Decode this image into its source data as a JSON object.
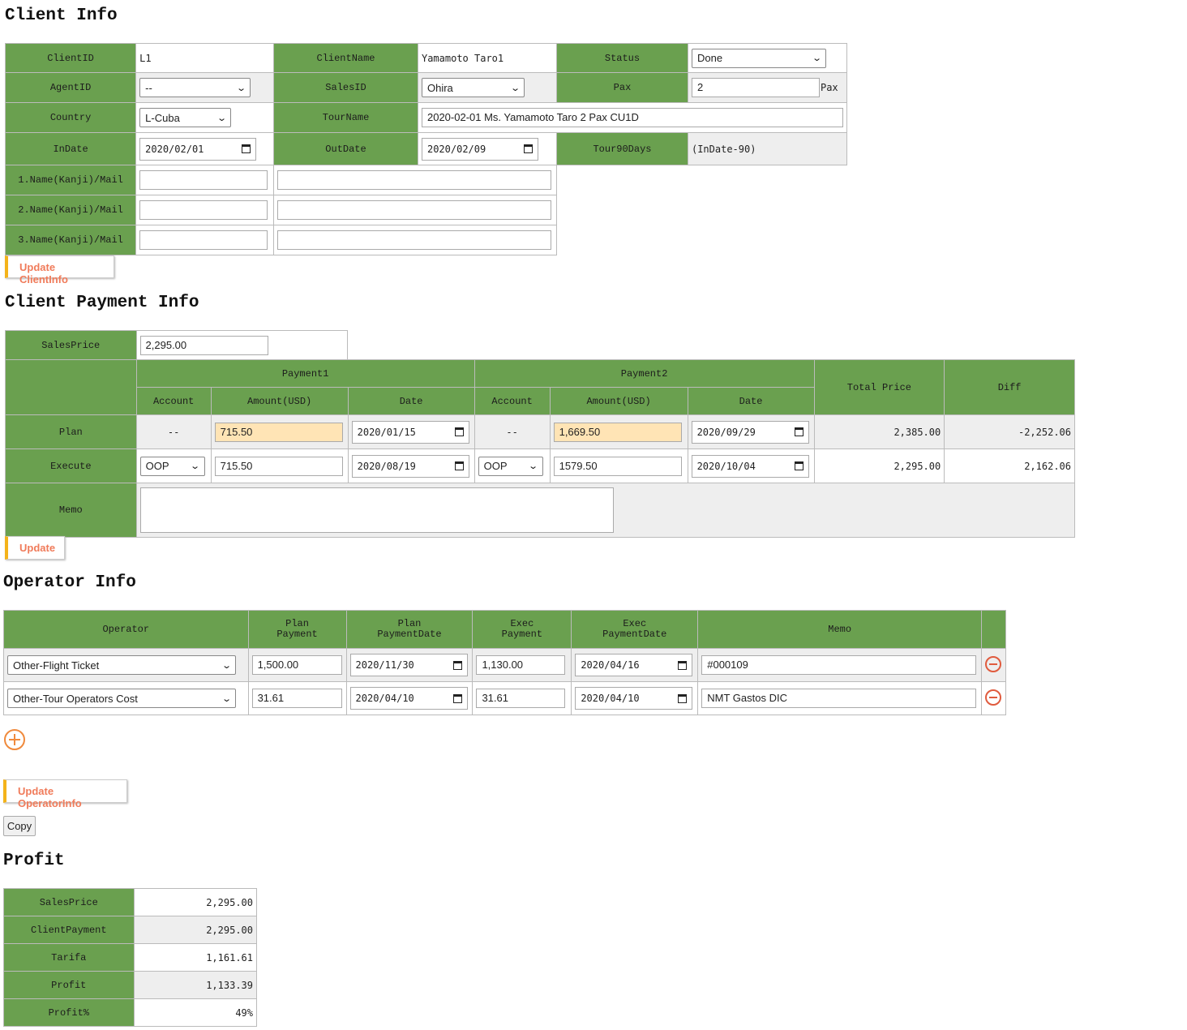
{
  "client_info": {
    "title": "Client Info",
    "client_id_label": "ClientID",
    "client_id": "L1",
    "client_name_label": "ClientName",
    "client_name": "Yamamoto Taro1",
    "status_label": "Status",
    "status": "Done",
    "agent_id_label": "AgentID",
    "agent_id": "--",
    "sales_id_label": "SalesID",
    "sales_id": "Ohira",
    "pax_label": "Pax",
    "pax": "2",
    "pax_unit": "Pax",
    "country_label": "Country",
    "country": "L-Cuba",
    "tour_name_label": "TourName",
    "tour_name": "2020-02-01 Ms. Yamamoto Taro 2 Pax CU1D",
    "in_date_label": "InDate",
    "in_date": "2020/02/01",
    "out_date_label": "OutDate",
    "out_date": "2020/02/09",
    "tour90_label": "Tour90Days",
    "tour90": "(InDate-90)",
    "name1_label": "1.Name(Kanji)/Mail",
    "name2_label": "2.Name(Kanji)/Mail",
    "name3_label": "3.Name(Kanji)/Mail",
    "update_button": "Update ClientInfo"
  },
  "payment_info": {
    "title": "Client Payment Info",
    "sales_price_label": "SalesPrice",
    "sales_price": "2,295.00",
    "payment1_label": "Payment1",
    "payment2_label": "Payment2",
    "total_price_label": "Total Price",
    "diff_label": "Diff",
    "account_label": "Account",
    "amount_label": "Amount(USD)",
    "date_label": "Date",
    "plan_label": "Plan",
    "plan_p1_account": "--",
    "plan_p1_amount": "715.50",
    "plan_p1_date": "2020/01/15",
    "plan_p2_account": "--",
    "plan_p2_amount": "1,669.50",
    "plan_p2_date": "2020/09/29",
    "plan_total": "2,385.00",
    "plan_diff": "-2,252.06",
    "execute_label": "Execute",
    "exec_p1_account": "OOP",
    "exec_p1_amount": "715.50",
    "exec_p1_date": "2020/08/19",
    "exec_p2_account": "OOP",
    "exec_p2_amount": "1579.50",
    "exec_p2_date": "2020/10/04",
    "exec_total": "2,295.00",
    "exec_diff": "2,162.06",
    "memo_label": "Memo",
    "update_button": "Update"
  },
  "operator_info": {
    "title": "Operator Info",
    "headers": {
      "operator": "Operator",
      "plan_payment_1": "Plan",
      "plan_payment_2": "Payment",
      "plan_date_1": "Plan",
      "plan_date_2": "PaymentDate",
      "exec_payment_1": "Exec",
      "exec_payment_2": "Payment",
      "exec_date_1": "Exec",
      "exec_date_2": "PaymentDate",
      "memo": "Memo"
    },
    "rows": [
      {
        "operator": "Other-Flight Ticket",
        "plan_payment": "1,500.00",
        "plan_date": "2020/11/30",
        "exec_payment": "1,130.00",
        "exec_date": "2020/04/16",
        "memo": "#000109"
      },
      {
        "operator": "Other-Tour Operators Cost",
        "plan_payment": "31.61",
        "plan_date": "2020/04/10",
        "exec_payment": "31.61",
        "exec_date": "2020/04/10",
        "memo": "NMT Gastos DIC"
      }
    ],
    "update_button": "Update OperatorInfo",
    "copy_button": "Copy"
  },
  "profit": {
    "title": "Profit",
    "rows": [
      {
        "label": "SalesPrice",
        "value": "2,295.00"
      },
      {
        "label": "ClientPayment",
        "value": "2,295.00"
      },
      {
        "label": "Tarifa",
        "value": "1,161.61"
      },
      {
        "label": "Profit",
        "value": "1,133.39"
      },
      {
        "label": "Profit%",
        "value": "49%"
      }
    ]
  },
  "colors": {
    "header_green": "#6aa04f",
    "accent_orange": "#f07b5a",
    "highlight": "#ffe4b5"
  }
}
